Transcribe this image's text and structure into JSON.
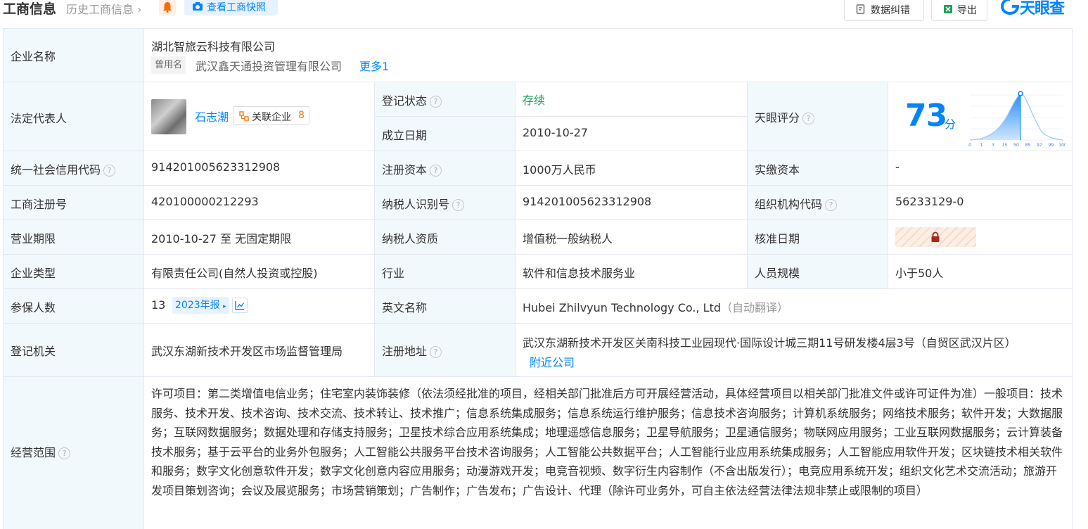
{
  "header": {
    "title": "工商信息",
    "history": "历史工商信息",
    "snapshot": "查看工商快照",
    "correct": "数据纠错",
    "export": "导出",
    "logo": "天眼查"
  },
  "rows": {
    "company_name": {
      "label": "企业名称",
      "value": "湖北智旅云科技有限公司",
      "former_tag": "曾用名",
      "former": "武汉鑫天通投资管理有限公司",
      "more": "更多1"
    },
    "legal_rep": {
      "label": "法定代表人",
      "name": "石志潮",
      "related_label": "关联企业",
      "related_count": "8"
    },
    "reg_status": {
      "label": "登记状态",
      "value": "存续"
    },
    "found_date": {
      "label": "成立日期",
      "value": "2010-10-27"
    },
    "score": {
      "label": "天眼评分",
      "value": "73",
      "unit": "分",
      "axis": [
        "0",
        "1",
        "3",
        "15",
        "50",
        "85",
        "97",
        "99",
        "100"
      ]
    },
    "credit_code": {
      "label": "统一社会信用代码",
      "value": "914201005623312908"
    },
    "reg_capital": {
      "label": "注册资本",
      "value": "1000万人民币"
    },
    "paid_capital": {
      "label": "实缴资本",
      "value": "-"
    },
    "reg_no": {
      "label": "工商注册号",
      "value": "420100000212293"
    },
    "tax_id": {
      "label": "纳税人识别号",
      "value": "914201005623312908"
    },
    "org_code": {
      "label": "组织机构代码",
      "value": "56233129-0"
    },
    "term": {
      "label": "营业期限",
      "value": "2010-10-27 至 无固定期限"
    },
    "tax_qual": {
      "label": "纳税人资质",
      "value": "增值税一般纳税人"
    },
    "approve_date": {
      "label": "核准日期"
    },
    "type": {
      "label": "企业类型",
      "value": "有限责任公司(自然人投资或控股)"
    },
    "industry": {
      "label": "行业",
      "value": "软件和信息技术服务业"
    },
    "staff": {
      "label": "人员规模",
      "value": "小于50人"
    },
    "insured": {
      "label": "参保人数",
      "value": "13",
      "report": "2023年报"
    },
    "en_name": {
      "label": "英文名称",
      "value": "Hubei Zhilvyun Technology Co., Ltd",
      "auto": "（自动翻译）"
    },
    "authority": {
      "label": "登记机关",
      "value": "武汉东湖新技术开发区市场监督管理局"
    },
    "address": {
      "label": "注册地址",
      "value": "武汉东湖新技术开发区关南科技工业园现代·国际设计城三期11号研发楼4层3号（自贸区武汉片区）",
      "nearby": "附近公司"
    },
    "scope": {
      "label": "经营范围",
      "value": "许可项目：第二类增值电信业务；住宅室内装饰装修（依法须经批准的项目，经相关部门批准后方可开展经营活动，具体经营项目以相关部门批准文件或许可证件为准）一般项目：技术服务、技术开发、技术咨询、技术交流、技术转让、技术推广；信息系统集成服务；信息系统运行维护服务；信息技术咨询服务；计算机系统服务；网络技术服务；软件开发；大数据服务；互联网数据服务；数据处理和存储支持服务；卫星技术综合应用系统集成；地理遥感信息服务；卫星导航服务；卫星通信服务；物联网应用服务；工业互联网数据服务；云计算装备技术服务；基于云平台的业务外包服务；人工智能公共服务平台技术咨询服务；人工智能公共数据平台；人工智能行业应用系统集成服务；人工智能应用软件开发；区块链技术相关软件和服务；数字文化创意软件开发；数字文化创意内容应用服务；动漫游戏开发；电竞音视频、数字衍生内容制作（不含出版发行）；电竞应用系统开发；组织文化艺术交流活动；旅游开发项目策划咨询；会议及展览服务；市场营销策划；广告制作；广告发布；广告设计、代理（除许可业务外，可自主依法经营法律法规非禁止或限制的项目）"
    }
  },
  "colors": {
    "accent": "#0084ff",
    "status_green": "#17a05d",
    "label_bg": "#f2f9fc",
    "orange": "#ff7a00"
  }
}
